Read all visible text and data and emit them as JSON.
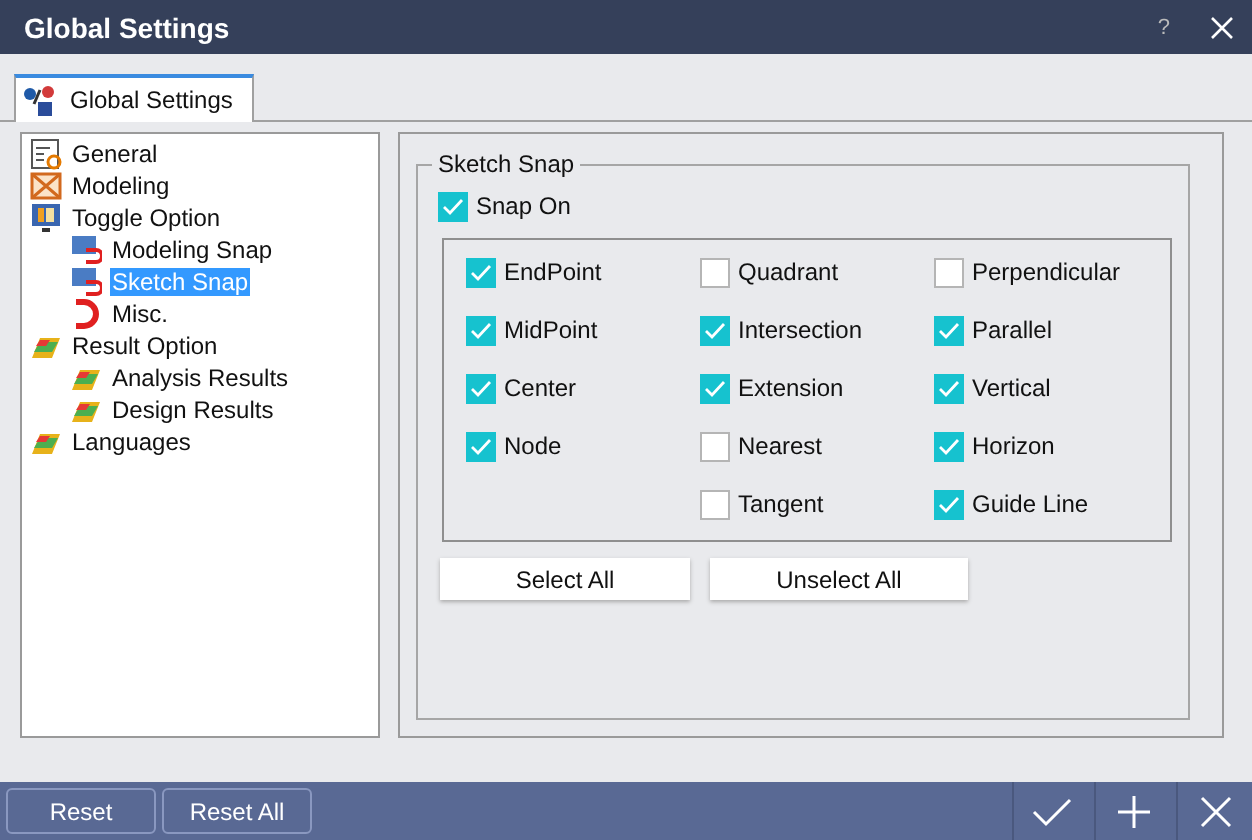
{
  "window": {
    "title": "Global Settings",
    "help": "?"
  },
  "tabs": [
    {
      "label": "Global Settings",
      "selected": true
    }
  ],
  "tree": [
    {
      "label": "General",
      "selected": false
    },
    {
      "label": "Modeling",
      "selected": false
    },
    {
      "label": "Toggle Option",
      "selected": false,
      "children": [
        {
          "label": "Modeling Snap",
          "selected": false
        },
        {
          "label": "Sketch Snap",
          "selected": true
        },
        {
          "label": "Misc.",
          "selected": false
        }
      ]
    },
    {
      "label": "Result Option",
      "selected": false,
      "children": [
        {
          "label": "Analysis Results",
          "selected": false
        },
        {
          "label": "Design Results",
          "selected": false
        }
      ]
    },
    {
      "label": "Languages",
      "selected": false
    }
  ],
  "group": {
    "title": "Sketch Snap",
    "snap_on": {
      "label": "Snap On",
      "checked": true
    },
    "columns": [
      [
        {
          "label": "EndPoint",
          "checked": true
        },
        {
          "label": "MidPoint",
          "checked": true
        },
        {
          "label": "Center",
          "checked": true
        },
        {
          "label": "Node",
          "checked": true
        }
      ],
      [
        {
          "label": "Quadrant",
          "checked": false
        },
        {
          "label": "Intersection",
          "checked": true
        },
        {
          "label": "Extension",
          "checked": true
        },
        {
          "label": "Nearest",
          "checked": false
        },
        {
          "label": "Tangent",
          "checked": false
        }
      ],
      [
        {
          "label": "Perpendicular",
          "checked": false
        },
        {
          "label": "Parallel",
          "checked": true
        },
        {
          "label": "Vertical",
          "checked": true
        },
        {
          "label": "Horizon",
          "checked": true
        },
        {
          "label": "Guide Line",
          "checked": true
        }
      ]
    ],
    "buttons": [
      "Select All",
      "Unselect All"
    ]
  },
  "footer": {
    "buttons": [
      "Reset",
      "Reset All"
    ]
  }
}
